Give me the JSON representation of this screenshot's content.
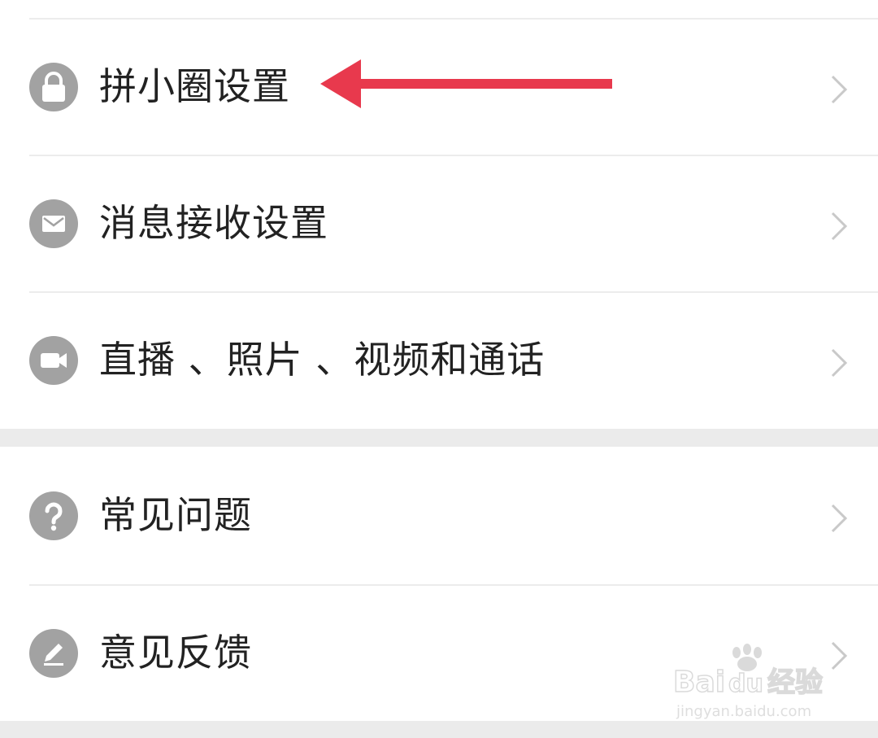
{
  "sections": [
    {
      "items": [
        {
          "label": "拼小圈设置",
          "icon": "lock-icon"
        },
        {
          "label": "消息接收设置",
          "icon": "envelope-icon"
        },
        {
          "label": "直播 、照片 、视频和通话",
          "icon": "video-camera-icon"
        }
      ]
    },
    {
      "items": [
        {
          "label": "常见问题",
          "icon": "question-icon"
        },
        {
          "label": "意见反馈",
          "icon": "pencil-icon"
        }
      ]
    }
  ],
  "colors": {
    "icon_bg": "#a2a2a2",
    "text": "#222222",
    "chevron": "#c9c9c9",
    "divider": "#ececec",
    "section_gap": "#ebebeb",
    "annotation_arrow": "#e8394d"
  },
  "watermark": {
    "brand": "Bai",
    "brand_suffix": "du",
    "product": "经验",
    "url": "jingyan.baidu.com"
  }
}
